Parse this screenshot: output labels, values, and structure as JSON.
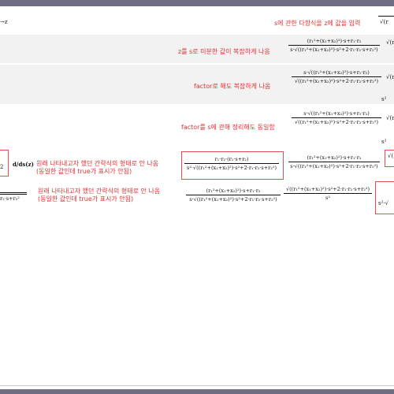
{
  "rows": [
    {
      "id": "r1",
      "note": "s에 관한 다항식을 z에 값을 입력",
      "left_math": "→z",
      "right_math": "√(r"
    },
    {
      "id": "r2",
      "note": "z를 s로 미분한 값이 복잡하게 나옴",
      "frac_num": "(r₁²+(x₁+x₂)²)·s+r₁·r₂",
      "frac_den": "s·√((r₁²+(x₁+x₂)²)·s²+2·r₁·r₂·s+r₂²)",
      "right_math": "√(r"
    },
    {
      "id": "r3",
      "note": "factor로 해도 복잡하게 나옴",
      "frac_num": "s·√((r₁²+(x₁+x₂)²)·s+r₁·r₂)",
      "frac_den": "√((r₁²+(x₁+x₂)²)·s²+2·r₁·r₂·s+r₂²)",
      "right_math": "√(r",
      "right_den": "s²"
    },
    {
      "id": "r4",
      "note": "factor를 s에 관해 정리해도 동일함",
      "frac_num": "s·√((r₁²+(x₁+x₂)²)·s+r₁·r₂)",
      "frac_den": "√((r₁²+(x₁+x₂)²)·s²+2·r₁·r₂·s+r₂²)",
      "right_math": "√(r",
      "right_den": "s²"
    },
    {
      "id": "r5",
      "left_math": "2",
      "derivative": "d/ds(z)",
      "note": "원래 나타내고자 했던 간략식의 형태로 안 나옴\n(동일한 값인데 true가 표시가 안됨)",
      "box_num": "r₁·r₂·(r₁·s+r₂)",
      "box_den": "s²·√((r₁²+(x₁+x₂)²)·s²+2·r₁·r₂·s+r₂²)",
      "frac_num": "(r₁²+(x₁+x₂)²)·s+r₁·r₂",
      "frac_den": "s·√((r₁²+(x₁+x₂)²)·s²+2·r₁·r₂·s+r₂²)",
      "right_math": "√("
    },
    {
      "id": "r6",
      "left_math": "r₂·s+r₂²",
      "note": "원래 나타내고자 했던 간략식의 형태로 안 나옴\n(동일한 값인데 true가 표시가 안됨)",
      "frac_num": "(r₁²+(x₁+x₂)²)·s+r₁·r₂",
      "frac_den": "s·√((r₁²+(x₁+x₂)²)·s²+2·r₁·r₂·s+r₂²)",
      "frac2_num": "√((r₁²+(x₁+x₂)²)·s²+2·r₁·r₂·s+r₂²)",
      "frac2_den": "s²",
      "right_math": "s²·√"
    }
  ]
}
